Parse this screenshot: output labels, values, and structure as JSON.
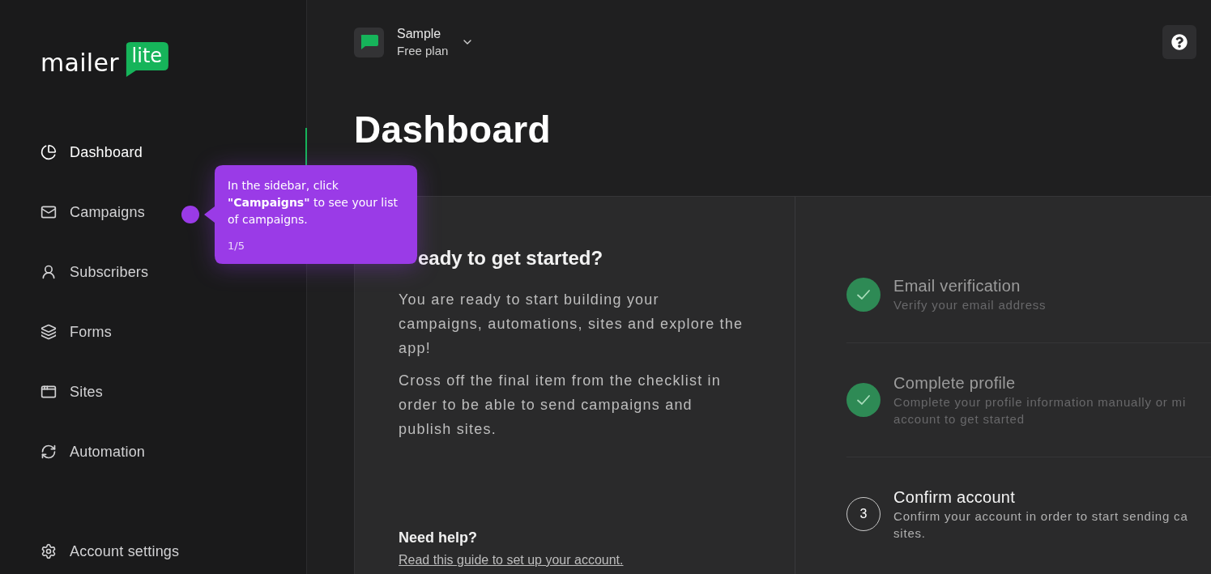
{
  "sidebar": {
    "logo": {
      "text": "mailer",
      "badge": "lite"
    },
    "items": [
      {
        "label": "Dashboard",
        "selected": true
      },
      {
        "label": "Campaigns",
        "selected": false
      },
      {
        "label": "Subscribers",
        "selected": false
      },
      {
        "label": "Forms",
        "selected": false
      },
      {
        "label": "Sites",
        "selected": false
      },
      {
        "label": "Automation",
        "selected": false
      }
    ],
    "settings_item": {
      "label": "Account settings",
      "selected": false
    }
  },
  "header": {
    "workspace": {
      "name": "Sample",
      "plan": "Free plan"
    }
  },
  "page_title": "Dashboard",
  "getting_started": {
    "title": "eady to get started?",
    "paragraphs": [
      "You are ready to start building your campaigns, automations, sites and explore the app!",
      "Cross off the final item from the checklist in order to be able to send campaigns and publish sites."
    ],
    "help": {
      "title": "Need help?",
      "link": "Read this guide to set up your account."
    }
  },
  "checklist": [
    {
      "title": "Email verification",
      "description_lines": [
        "Verify your email address"
      ],
      "completed": true
    },
    {
      "title": "Complete profile",
      "description_lines": [
        "Complete your profile information manually or mi",
        "account to get started"
      ],
      "completed": true
    },
    {
      "number": "3",
      "title": "Confirm account",
      "description_lines": [
        "Confirm your account in order to start sending ca",
        "sites."
      ],
      "completed": false
    }
  ],
  "tooltip": {
    "text": "In the sidebar, click **\"Campaigns\"** to see your list of campaigns.",
    "step": "1/5"
  }
}
